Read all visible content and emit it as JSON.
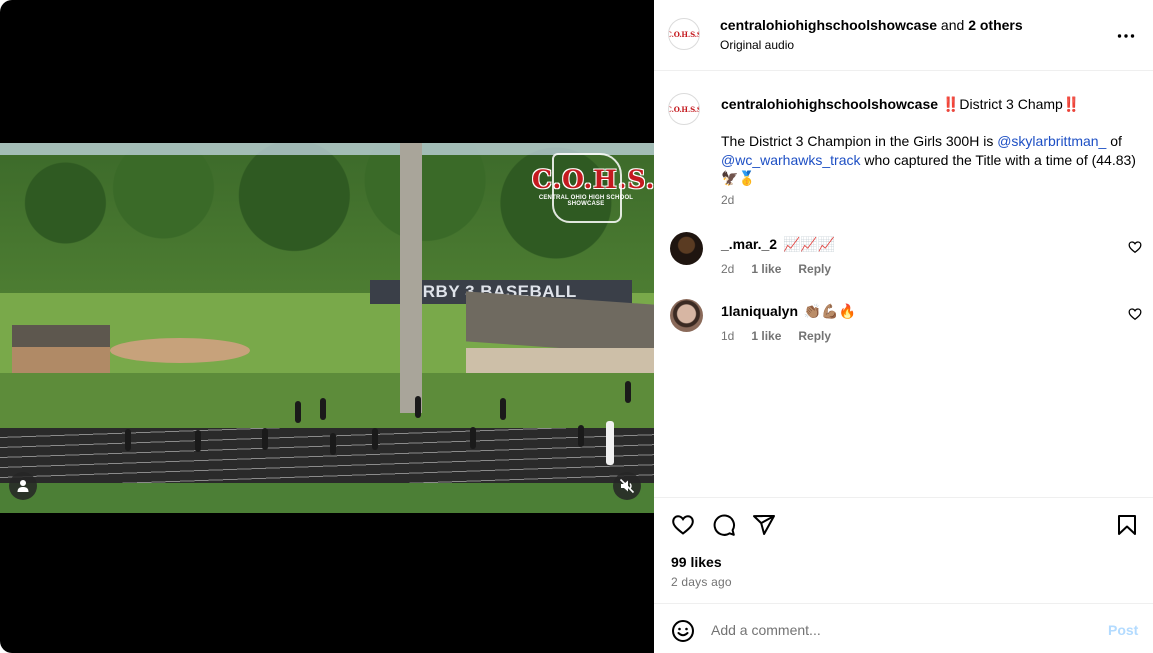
{
  "header": {
    "username": "centralohiohighschoolshowcase",
    "and_text": " and ",
    "others": "2 others",
    "audio": "Original audio",
    "logo_text": "C.O.H.S.S"
  },
  "video": {
    "watermark_title": "C.O.H.S.S",
    "watermark_subtitle": "CENTRAL OHIO HIGH SCHOOL SHOWCASE",
    "sign_text": "ARBY 3 BASEBALL",
    "muted": true
  },
  "caption": {
    "username": "centralohiohighschoolshowcase",
    "bang1": "‼️",
    "title": "District 3 Champ",
    "bang2": "‼️",
    "line1": "The District 3 Champion in the Girls 300H is ",
    "mention1": "@skylarbrittman_",
    "of": "of ",
    "mention2": "@wc_warhawks_track",
    "line2": " who captured the Title with a time of (44.83) 🦅🥇",
    "time": "2d"
  },
  "comments": [
    {
      "username": "_.mar._2",
      "text": "📈📈📈",
      "time": "2d",
      "likes": "1 like",
      "reply": "Reply"
    },
    {
      "username": "1laniqualyn",
      "text": "👏🏽💪🏽🔥",
      "time": "1d",
      "likes": "1 like",
      "reply": "Reply"
    }
  ],
  "actions": {
    "likes": "99 likes",
    "posted": "2 days ago"
  },
  "add_comment": {
    "placeholder": "Add a comment...",
    "post_label": "Post"
  },
  "colors": {
    "mention": "#1d4fc4",
    "secondary_text": "#737373",
    "post_disabled": "#b3dbff",
    "brand_red": "#c41a1f"
  }
}
